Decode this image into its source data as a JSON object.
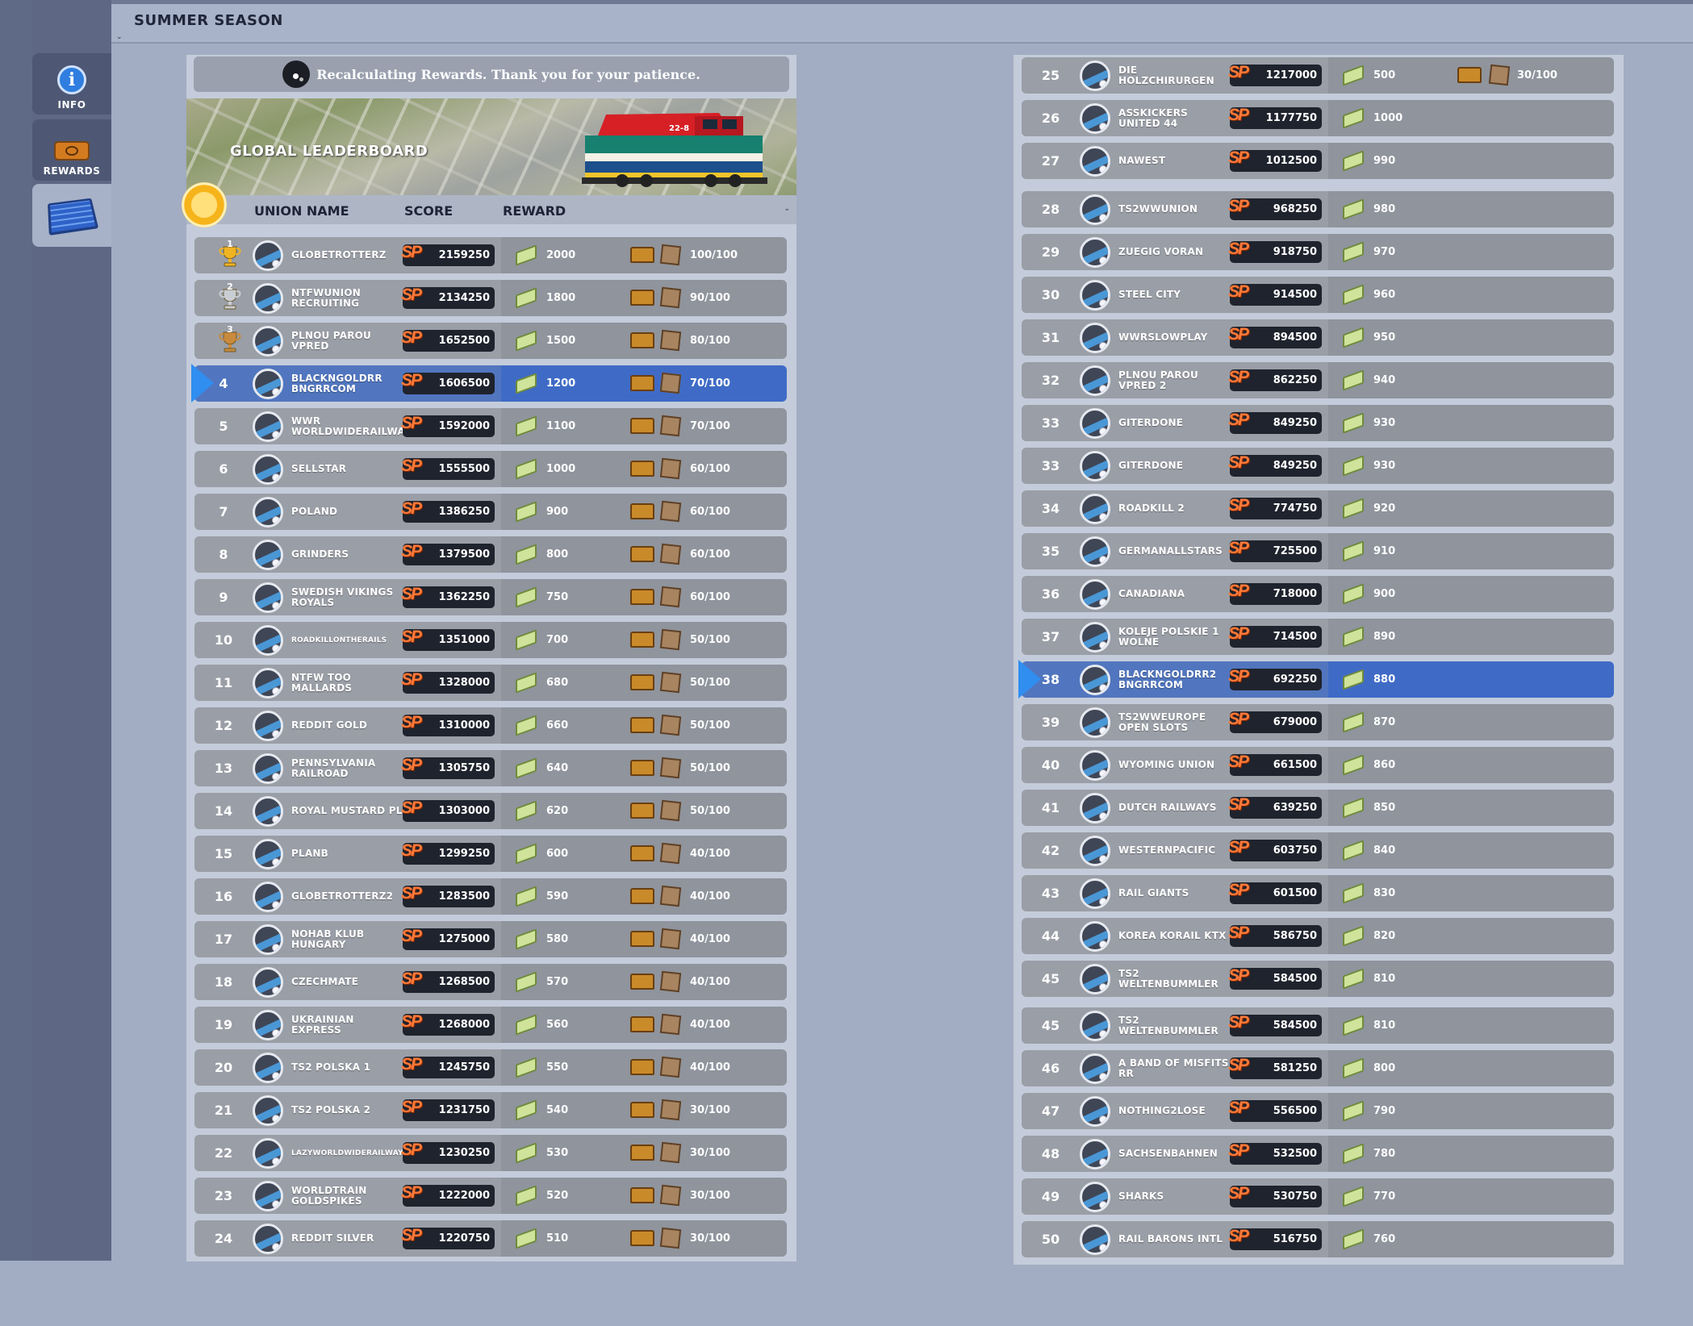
{
  "window": {
    "title": "SUMMER SEASON"
  },
  "sidebar": {
    "items": [
      {
        "label": "INFO",
        "icon": "info-icon"
      },
      {
        "label": "REWARDS",
        "icon": "ticket-icon"
      },
      {
        "label": "",
        "icon": "leaderboard-icon"
      }
    ]
  },
  "notice": {
    "text": "Recalculating Rewards. Thank you for your patience."
  },
  "banner": {
    "title": "GLOBAL LEADERBOARD",
    "train_number": "22-8"
  },
  "headers": {
    "union_name": "UNION NAME",
    "score": "SCORE",
    "reward": "REWARD"
  },
  "colors": {
    "highlight_row": "#3f6bc6",
    "score_pill": "#1f232d",
    "sp_badge": "#ff7a3a",
    "row": "#8f949d"
  },
  "rows_left": [
    {
      "rank": "1",
      "name": "GLOBETROTTERZ",
      "score": "2159250",
      "cash": "2000",
      "crate": "100/100",
      "trophy": "gold"
    },
    {
      "rank": "2",
      "name": "NTFWUNION RECRUITING",
      "score": "2134250",
      "cash": "1800",
      "crate": "90/100",
      "trophy": "silver"
    },
    {
      "rank": "3",
      "name": "PLNOU PAROU VPRED",
      "score": "1652500",
      "cash": "1500",
      "crate": "80/100",
      "trophy": "bronze"
    },
    {
      "rank": "4",
      "name": "BLACKNGOLDRR BNGRRCOM",
      "score": "1606500",
      "cash": "1200",
      "crate": "70/100",
      "mine": true
    },
    {
      "rank": "5",
      "name": "WWR WORLDWIDERAILWAYS",
      "score": "1592000",
      "cash": "1100",
      "crate": "70/100"
    },
    {
      "rank": "6",
      "name": "SELLSTAR",
      "score": "1555500",
      "cash": "1000",
      "crate": "60/100"
    },
    {
      "rank": "7",
      "name": "POLAND",
      "score": "1386250",
      "cash": "900",
      "crate": "60/100"
    },
    {
      "rank": "8",
      "name": "GRINDERS",
      "score": "1379500",
      "cash": "800",
      "crate": "60/100"
    },
    {
      "rank": "9",
      "name": "SWEDISH VIKINGS ROYALS",
      "score": "1362250",
      "cash": "750",
      "crate": "60/100"
    },
    {
      "rank": "10",
      "name": "ROADKILLONTHERAILS",
      "score": "1351000",
      "cash": "700",
      "crate": "50/100",
      "small": true
    },
    {
      "rank": "11",
      "name": "NTFW TOO MALLARDS",
      "score": "1328000",
      "cash": "680",
      "crate": "50/100"
    },
    {
      "rank": "12",
      "name": "REDDIT GOLD",
      "score": "1310000",
      "cash": "660",
      "crate": "50/100"
    },
    {
      "rank": "13",
      "name": "PENNSYLVANIA RAILROAD",
      "score": "1305750",
      "cash": "640",
      "crate": "50/100"
    },
    {
      "rank": "14",
      "name": "ROYAL MUSTARD PL",
      "score": "1303000",
      "cash": "620",
      "crate": "50/100"
    },
    {
      "rank": "15",
      "name": "PLANB",
      "score": "1299250",
      "cash": "600",
      "crate": "40/100"
    },
    {
      "rank": "16",
      "name": "GLOBETROTTERZ2",
      "score": "1283500",
      "cash": "590",
      "crate": "40/100"
    },
    {
      "rank": "17",
      "name": "NOHAB KLUB HUNGARY",
      "score": "1275000",
      "cash": "580",
      "crate": "40/100"
    },
    {
      "rank": "18",
      "name": "CZECHMATE",
      "score": "1268500",
      "cash": "570",
      "crate": "40/100"
    },
    {
      "rank": "19",
      "name": "UKRAINIAN EXPRESS",
      "score": "1268000",
      "cash": "560",
      "crate": "40/100"
    },
    {
      "rank": "20",
      "name": "TS2 POLSKA 1",
      "score": "1245750",
      "cash": "550",
      "crate": "40/100"
    },
    {
      "rank": "21",
      "name": "TS2 POLSKA 2",
      "score": "1231750",
      "cash": "540",
      "crate": "30/100"
    },
    {
      "rank": "22",
      "name": "LAZYWORLDWIDERAILWAYS",
      "score": "1230250",
      "cash": "530",
      "crate": "30/100",
      "small": true
    },
    {
      "rank": "23",
      "name": "WORLDTRAIN GOLDSPIKES",
      "score": "1222000",
      "cash": "520",
      "crate": "30/100"
    },
    {
      "rank": "24",
      "name": "REDDIT SILVER",
      "score": "1220750",
      "cash": "510",
      "crate": "30/100"
    }
  ],
  "rows_right": [
    {
      "rank": "25",
      "name": "DIE HOLZCHIRURGEN",
      "score": "1217000",
      "cash": "500",
      "crate": "30/100"
    },
    {
      "rank": "26",
      "name": "ASSKICKERS UNITED 44",
      "score": "1177750",
      "cash": "1000"
    },
    {
      "rank": "27",
      "name": "NAWEST",
      "score": "1012500",
      "cash": "990"
    },
    {
      "rank": "28",
      "name": "TS2WWUNION",
      "score": "968250",
      "cash": "980"
    },
    {
      "rank": "29",
      "name": "ZUEGIG VORAN",
      "score": "918750",
      "cash": "970"
    },
    {
      "rank": "30",
      "name": "STEEL CITY",
      "score": "914500",
      "cash": "960"
    },
    {
      "rank": "31",
      "name": "WWRSLOWPLAY",
      "score": "894500",
      "cash": "950"
    },
    {
      "rank": "32",
      "name": "PLNOU PAROU VPRED 2",
      "score": "862250",
      "cash": "940"
    },
    {
      "rank": "33",
      "name": "GITERDONE",
      "score": "849250",
      "cash": "930"
    },
    {
      "rank": "33",
      "name": "GITERDONE",
      "score": "849250",
      "cash": "930"
    },
    {
      "rank": "34",
      "name": "ROADKILL 2",
      "score": "774750",
      "cash": "920"
    },
    {
      "rank": "35",
      "name": "GERMANALLSTARS",
      "score": "725500",
      "cash": "910"
    },
    {
      "rank": "36",
      "name": "CANADIANA",
      "score": "718000",
      "cash": "900"
    },
    {
      "rank": "37",
      "name": "KOLEJE POLSKIE 1 WOLNE",
      "score": "714500",
      "cash": "890"
    },
    {
      "rank": "38",
      "name": "BLACKNGOLDRR2 BNGRRCOM",
      "score": "692250",
      "cash": "880",
      "mine": true
    },
    {
      "rank": "39",
      "name": "TS2WWEUROPE OPEN SLOTS",
      "score": "679000",
      "cash": "870"
    },
    {
      "rank": "40",
      "name": "WYOMING UNION",
      "score": "661500",
      "cash": "860"
    },
    {
      "rank": "41",
      "name": "DUTCH RAILWAYS",
      "score": "639250",
      "cash": "850"
    },
    {
      "rank": "42",
      "name": "WESTERNPACIFIC",
      "score": "603750",
      "cash": "840"
    },
    {
      "rank": "43",
      "name": "RAIL GIANTS",
      "score": "601500",
      "cash": "830"
    },
    {
      "rank": "44",
      "name": "KOREA KORAIL KTX",
      "score": "586750",
      "cash": "820"
    },
    {
      "rank": "45",
      "name": "TS2 WELTENBUMMLER",
      "score": "584500",
      "cash": "810"
    },
    {
      "rank": "45",
      "name": "TS2 WELTENBUMMLER",
      "score": "584500",
      "cash": "810"
    },
    {
      "rank": "46",
      "name": "A BAND OF MISFITS RR",
      "score": "581250",
      "cash": "800"
    },
    {
      "rank": "47",
      "name": "NOTHING2LOSE",
      "score": "556500",
      "cash": "790"
    },
    {
      "rank": "48",
      "name": "SACHSENBAHNEN",
      "score": "532500",
      "cash": "780"
    },
    {
      "rank": "49",
      "name": "SHARKS",
      "score": "530750",
      "cash": "770"
    },
    {
      "rank": "50",
      "name": "RAIL BARONS INTL",
      "score": "516750",
      "cash": "760"
    }
  ]
}
